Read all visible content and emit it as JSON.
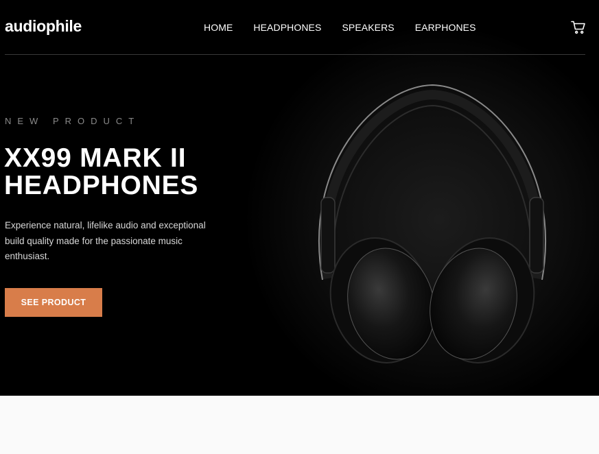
{
  "brand": {
    "logo": "audiophile"
  },
  "nav": {
    "items": [
      "HOME",
      "HEADPHONES",
      "SPEAKERS",
      "EARPHONES"
    ]
  },
  "cart": {
    "icon": "cart-icon"
  },
  "hero": {
    "overline": "NEW PRODUCT",
    "title_line1": "XX99 MARK II",
    "title_line2": "HEADPHONES",
    "description": "Experience natural, lifelike audio and exceptional build quality made for the passionate music enthusiast.",
    "cta_label": "SEE PRODUCT"
  },
  "colors": {
    "accent": "#d87d4a",
    "hero_bg": "#000000",
    "page_bg": "#fafafa"
  }
}
